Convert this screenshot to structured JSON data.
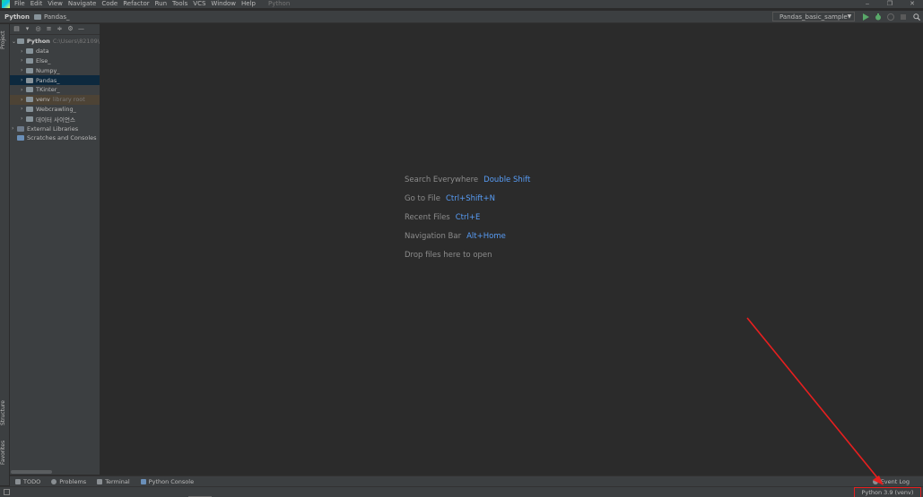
{
  "menubar": {
    "items": [
      "File",
      "Edit",
      "View",
      "Navigate",
      "Code",
      "Refactor",
      "Run",
      "Tools",
      "VCS",
      "Window",
      "Help"
    ],
    "window_title": "Python",
    "controls": {
      "minimize": "‒",
      "maximize": "❐",
      "close": "✕"
    }
  },
  "navbar": {
    "breadcrumb": [
      "Python",
      "Pandas_"
    ],
    "run_config": "Pandas_basic_sample"
  },
  "left_strip": {
    "project_tab": "Project",
    "structure_tab": "Structure",
    "favorites_tab": "Favorites"
  },
  "project_tree": {
    "root": {
      "name": "Python",
      "path": "C:\\Users\\82109\\"
    },
    "children": [
      {
        "name": "data"
      },
      {
        "name": "Else_"
      },
      {
        "name": "Numpy_"
      },
      {
        "name": "Pandas_"
      },
      {
        "name": "TKinter_"
      },
      {
        "name": "venv",
        "hint": "library root"
      },
      {
        "name": "Webcrawling_"
      },
      {
        "name": "데이터 사이언스"
      }
    ],
    "external_libraries": "External Libraries",
    "scratches": "Scratches and Consoles"
  },
  "editor_hints": [
    {
      "label": "Search Everywhere",
      "key": "Double Shift"
    },
    {
      "label": "Go to File",
      "key": "Ctrl+Shift+N"
    },
    {
      "label": "Recent Files",
      "key": "Ctrl+E"
    },
    {
      "label": "Navigation Bar",
      "key": "Alt+Home"
    },
    {
      "label": "Drop files here to open",
      "key": ""
    }
  ],
  "tool_windows": [
    "TODO",
    "Problems",
    "Terminal",
    "Python Console"
  ],
  "event_log": "Event Log",
  "status": {
    "interpreter": "Python 3.9 (venv)"
  },
  "colors": {
    "accent_key": "#589df6",
    "annotation": "#e81f1f",
    "selection": "#0d293e"
  }
}
